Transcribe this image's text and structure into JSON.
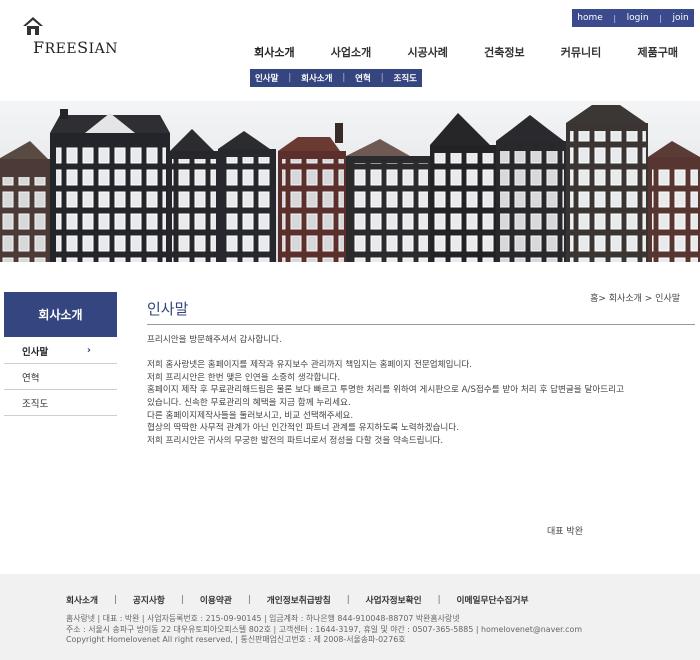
{
  "logo": {
    "text_prefix": "F",
    "text_main": "REE",
    "text_s": "S",
    "text_rest": "IAN",
    "icon": "house-icon"
  },
  "util_nav": [
    "home",
    "login",
    "join"
  ],
  "gnb": [
    "회사소개",
    "사업소개",
    "시공사례",
    "건축정보",
    "커뮤니티",
    "제품구매"
  ],
  "snb": [
    "인사말",
    "회사소개",
    "연혁",
    "조직도"
  ],
  "side": {
    "title": "회사소개",
    "items": [
      {
        "label": "인사말",
        "active": true
      },
      {
        "label": "연혁",
        "active": false
      },
      {
        "label": "조직도",
        "active": false
      }
    ],
    "chevron": "›"
  },
  "content": {
    "title": "인사말",
    "breadcrumb": "홈> 회사소개 > 인사말",
    "greeting": "프리시안을 방문해주셔서 감사합니다.",
    "paragraph": [
      "저희 홈사랑넷은 홈페이지를 제작과 유지보수 관리까지 책임지는 홈페이지 전문업체입니다.",
      "저희 프리시안은 한번 맺은 인연을 소중히 생각합니다.",
      "홈페이지 제작 후 무료관리해드림은 물론 보다 빠르고 투명한 처리를 위하여 게시판으로 A/S접수를 받아 처리 후 답변글을 달아드리고",
      "있습니다. 신속한 무료관리의 혜택을 지금 함께 누리세요.",
      "다른 홈페이지제작사들을 둘러보시고, 비교 선택해주세요.",
      "협상의 딱딱한 사무적 관계가 아닌 인간적인 파트너 관계를 유지하도록 노력하겠습니다.",
      "저희 프리시안은 귀사의 무궁한 발전의 파트너로서 정성을 다할 것을 약속드립니다."
    ],
    "signature": "대표 박완"
  },
  "footer": {
    "links": [
      "회사소개",
      "공지사항",
      "이용약관",
      "개인정보취급방침",
      "사업자정보확인",
      "이메일무단수집거부"
    ],
    "info": [
      "홈사랑넷  |  대표 : 박완  |  사업자등록번호 : 215-09-90145  |  입금계좌 : 하나은행 844-910048-88707 박완홈사랑넷",
      "주소 : 서울시 송파구 방이동 22 대우유토피아오피스텔 802호  |  고객센터 : 1644-3197, 휴일 및 야간 : 0507-365-5885  |  homelovenet@naver.com",
      "Copyright Homelovenet All right reserved,  |  통신판매업신고번호 : 제 2008-서울송파-0276호"
    ]
  },
  "colors": {
    "brand_navy": "#35457f",
    "util_bar": "#3a4a8c",
    "footer_bg": "#f1f1f1"
  }
}
